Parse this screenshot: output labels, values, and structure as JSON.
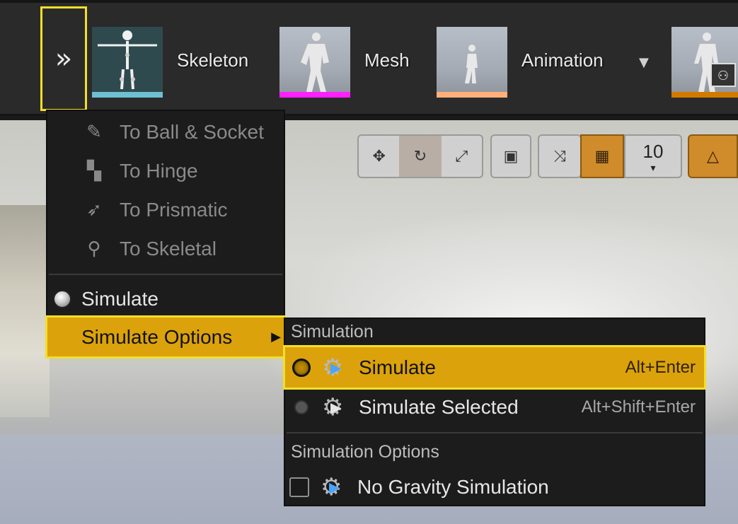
{
  "toolbar": {
    "expand_glyph": "»",
    "assets": [
      {
        "label": "Skeleton",
        "bar_color": "#6ec0d2"
      },
      {
        "label": "Mesh",
        "bar_color": "#ff1fff"
      },
      {
        "label": "Animation",
        "bar_color": "#ffb07a"
      },
      {
        "label": "",
        "bar_color": "#d27a00"
      }
    ],
    "animation_dropdown_glyph": "▼"
  },
  "viewport_tools": {
    "translate_icon": "✥",
    "rotate_icon": "↻",
    "scale_icon": "⤢",
    "world_icon": "▣",
    "surface_snap_icon": "⤨",
    "grid_icon": "▦",
    "grid_value": "10",
    "grid_caret": "▾",
    "rotation_snap_icon": "△"
  },
  "context_menu": {
    "items": [
      {
        "label": "To Ball & Socket",
        "icon": "✎"
      },
      {
        "label": "To Hinge",
        "icon": "▚"
      },
      {
        "label": "To Prismatic",
        "icon": "➶"
      },
      {
        "label": "To Skeletal",
        "icon": "⚲"
      }
    ],
    "simulate_label": "Simulate",
    "simulate_options_label": "Simulate Options",
    "submenu_arrow": "▶"
  },
  "submenu": {
    "section_simulation": "Simulation",
    "simulate": {
      "label": "Simulate",
      "shortcut": "Alt+Enter"
    },
    "simulate_selected": {
      "label": "Simulate Selected",
      "shortcut": "Alt+Shift+Enter"
    },
    "section_options": "Simulation Options",
    "no_gravity": {
      "label": "No Gravity Simulation",
      "checked": false
    }
  },
  "colors": {
    "highlight": "#dba20b",
    "focus_outline": "#f2df2a",
    "menu_bg": "#1c1c1c"
  }
}
